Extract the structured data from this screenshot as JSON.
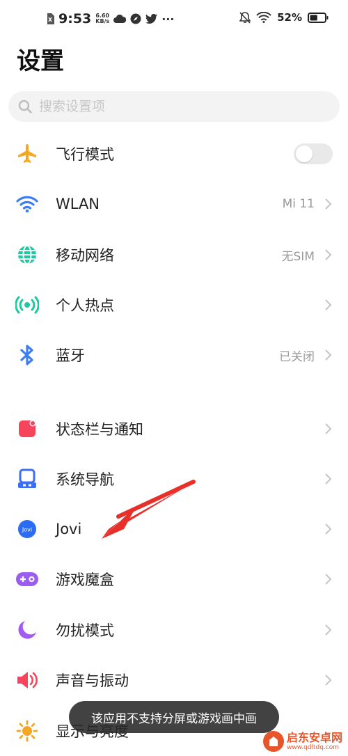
{
  "status_bar": {
    "time": "9:53",
    "speed_value": "6.60",
    "speed_unit": "KB/s",
    "more": "···",
    "battery_text": "52%",
    "battery_level": 0.52
  },
  "page_title": "设置",
  "search": {
    "placeholder": "搜索设置项"
  },
  "group1": [
    {
      "label": "飞行模式",
      "icon": "airplane-icon",
      "toggle": false
    },
    {
      "label": "WLAN",
      "icon": "wifi-icon",
      "value": "Mi 11"
    },
    {
      "label": "移动网络",
      "icon": "globe-icon",
      "value": "无SIM"
    },
    {
      "label": "个人热点",
      "icon": "hotspot-icon"
    },
    {
      "label": "蓝牙",
      "icon": "bluetooth-icon",
      "value": "已关闭"
    }
  ],
  "group2": [
    {
      "label": "状态栏与通知",
      "icon": "notification-icon"
    },
    {
      "label": "系统导航",
      "icon": "navigation-icon"
    },
    {
      "label": "Jovi",
      "icon": "jovi-icon",
      "icon_text": "Jovi"
    },
    {
      "label": "游戏魔盒",
      "icon": "gamepad-icon"
    },
    {
      "label": "勿扰模式",
      "icon": "moon-icon"
    },
    {
      "label": "声音与振动",
      "icon": "speaker-icon"
    },
    {
      "label": "显示与亮度",
      "icon": "sun-icon"
    }
  ],
  "toast": "该应用不支持分屏或游戏画中画",
  "watermark": {
    "name": "启东安卓网",
    "url": "www.qdltdq.com"
  },
  "colors": {
    "airplane": "#f5a623",
    "wifi": "#3d7ef5",
    "mobile": "#1ec8a0",
    "hotspot": "#1ec8a0",
    "bluetooth": "#3d7ef5",
    "notification": "#f5455c",
    "navigation": "#3d6ef5",
    "jovi": "#3d7ef5",
    "game": "#9b5cf0",
    "moon": "#a35cf0",
    "speaker": "#f5455c",
    "sun": "#f5a623",
    "arrow": "#e8302a"
  }
}
